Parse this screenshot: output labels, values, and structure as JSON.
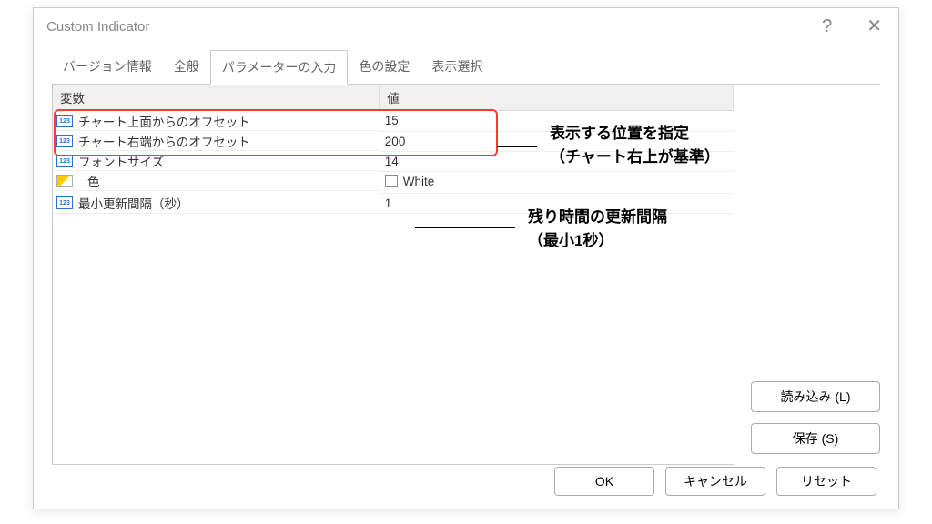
{
  "window": {
    "title": "Custom Indicator"
  },
  "tabs": {
    "t0": "バージョン情報",
    "t1": "全般",
    "t2": "パラメーターの入力",
    "t3": "色の設定",
    "t4": "表示選択"
  },
  "table": {
    "headers": {
      "variable": "変数",
      "value": "値"
    },
    "rows": {
      "r0": {
        "name": "チャート上面からのオフセット",
        "value": "15"
      },
      "r1": {
        "name": "チャート右端からのオフセット",
        "value": "200"
      },
      "r2": {
        "name": "フォントサイズ",
        "value": "14"
      },
      "r3": {
        "name": "色",
        "value": "White"
      },
      "r4": {
        "name": "最小更新間隔（秒）",
        "value": "1"
      }
    }
  },
  "side_buttons": {
    "load": "読み込み (L)",
    "save": "保存 (S)"
  },
  "bottom_buttons": {
    "ok": "OK",
    "cancel": "キャンセル",
    "reset": "リセット"
  },
  "annotations": {
    "a1_l1": "表示する位置を指定",
    "a1_l2": "（チャート右上が基準）",
    "a2_l1": "残り時間の更新間隔",
    "a2_l2": "（最小1秒）"
  }
}
